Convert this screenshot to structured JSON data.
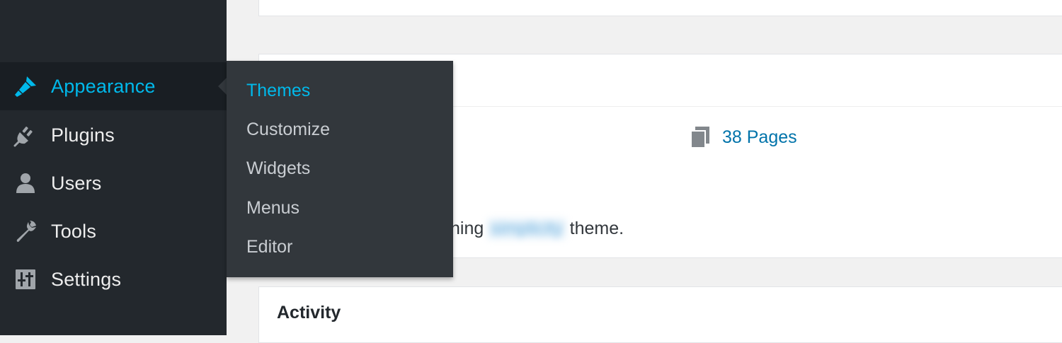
{
  "sidebar": {
    "items": [
      {
        "label": "Appearance",
        "icon": "paintbrush-icon",
        "current": true
      },
      {
        "label": "Plugins",
        "icon": "plug-icon",
        "current": false
      },
      {
        "label": "Users",
        "icon": "user-icon",
        "current": false
      },
      {
        "label": "Tools",
        "icon": "wrench-icon",
        "current": false
      },
      {
        "label": "Settings",
        "icon": "sliders-icon",
        "current": false
      }
    ]
  },
  "submenu": {
    "items": [
      {
        "label": "Themes",
        "current": true
      },
      {
        "label": "Customize"
      },
      {
        "label": "Widgets"
      },
      {
        "label": "Menus"
      },
      {
        "label": "Editor"
      }
    ]
  },
  "glance": {
    "pages_link": "38 Pages",
    "theme_prefix": "ning",
    "theme_name": "simplicity",
    "theme_suffix": "theme."
  },
  "activity": {
    "title": "Activity"
  },
  "colors": {
    "sidebar_bg": "#23282d",
    "submenu_bg": "#32373c",
    "accent": "#00b9eb",
    "link": "#0073aa",
    "page_bg": "#f1f1f1"
  }
}
